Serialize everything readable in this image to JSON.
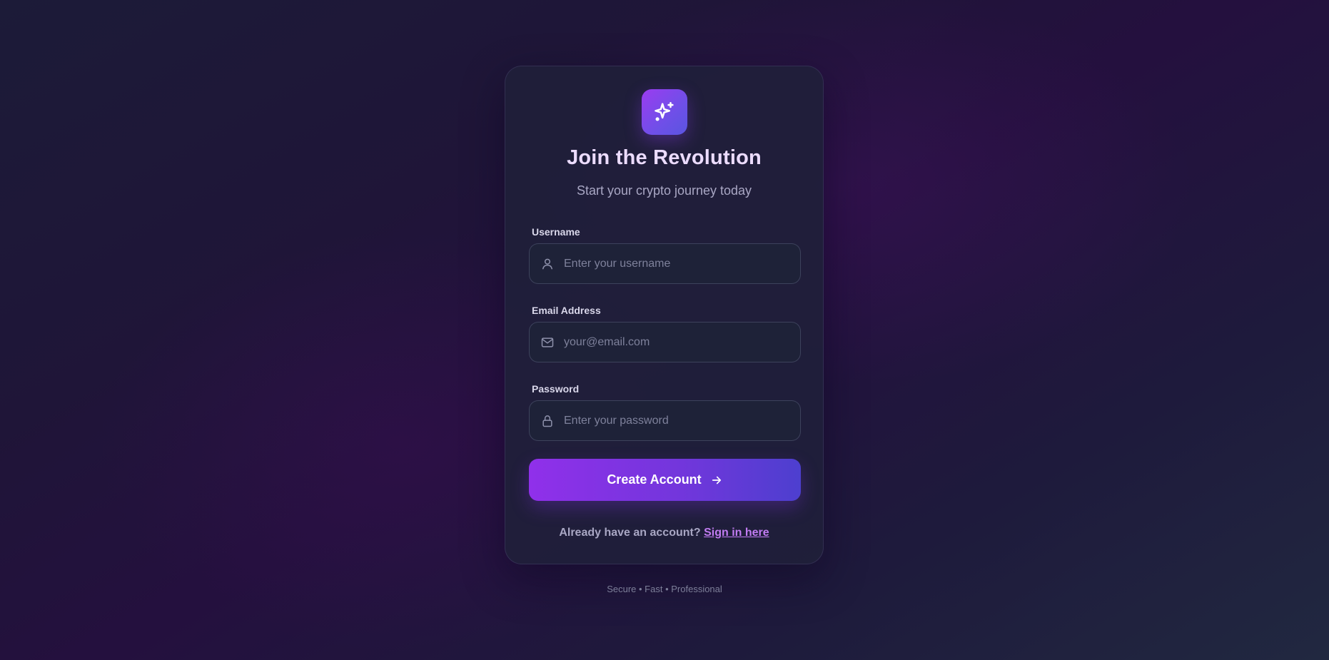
{
  "header": {
    "title": "Join the Revolution",
    "subtitle": "Start your crypto journey today",
    "logo_icon": "sparkles-icon"
  },
  "form": {
    "username": {
      "label": "Username",
      "placeholder": "Enter your username",
      "value": "",
      "icon": "user-icon"
    },
    "email": {
      "label": "Email Address",
      "placeholder": "your@email.com",
      "value": "",
      "icon": "mail-icon"
    },
    "password": {
      "label": "Password",
      "placeholder": "Enter your password",
      "value": "",
      "icon": "lock-icon"
    },
    "submit_label": "Create Account",
    "submit_icon": "arrow-right-icon"
  },
  "signin": {
    "prompt": "Already have an account?",
    "link_label": "Sign in here"
  },
  "footer": {
    "tagline": "Secure • Fast • Professional"
  },
  "colors": {
    "accent_start": "#9030ea",
    "accent_end": "#4d3fcf",
    "link": "#c27cf3",
    "card_bg": "#201f3a"
  }
}
